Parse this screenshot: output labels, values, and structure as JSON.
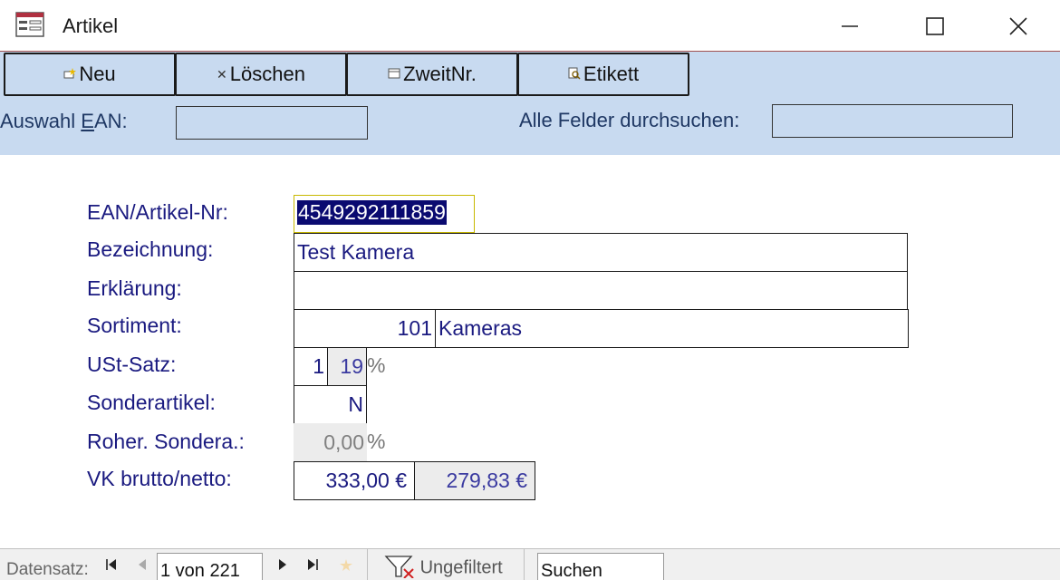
{
  "window": {
    "title": "Artikel",
    "minimize_icon": "minimize-icon",
    "maximize_icon": "maximize-icon",
    "close_icon": "close-icon"
  },
  "toolbar": {
    "new_label": "Neu",
    "delete_label": "Löschen",
    "second_nr_label": "ZweitNr.",
    "label_label": "Etikett"
  },
  "search": {
    "ean_label_pre": "Auswahl ",
    "ean_label_access": "E",
    "ean_label_post": "AN:",
    "ean_value": "",
    "all_fields_label": "Alle Felder durchsuchen:",
    "all_fields_value": ""
  },
  "form": {
    "ean_label": "EAN/Artikel-Nr:",
    "ean_value": "4549292111859",
    "bezeichnung_label": "Bezeichnung:",
    "bezeichnung_value": "Test Kamera",
    "erklaerung_label": "Erklärung:",
    "erklaerung_value": "",
    "sortiment_label": "Sortiment:",
    "sortiment_code": "101",
    "sortiment_name": "Kameras",
    "ust_label": "USt-Satz:",
    "ust_code": "1",
    "ust_rate": "19",
    "ust_pct": "%",
    "sonder_label": "Sonderartikel:",
    "sonder_value": "N",
    "roher_label": "Roher. Sondera.:",
    "roher_value": "0,00",
    "roher_pct": "%",
    "vk_label": "VK brutto/netto:",
    "vk_brutto": "333,00 €",
    "vk_netto": "279,83 €"
  },
  "statusbar": {
    "record_label": "Datensatz:",
    "record_position": "1 von 221",
    "filter_label": "Ungefiltert",
    "search_placeholder": "Suchen"
  },
  "colors": {
    "header_band": "#c8daf0",
    "form_text": "#1a1a80",
    "selection_bg": "#0a0a70"
  }
}
